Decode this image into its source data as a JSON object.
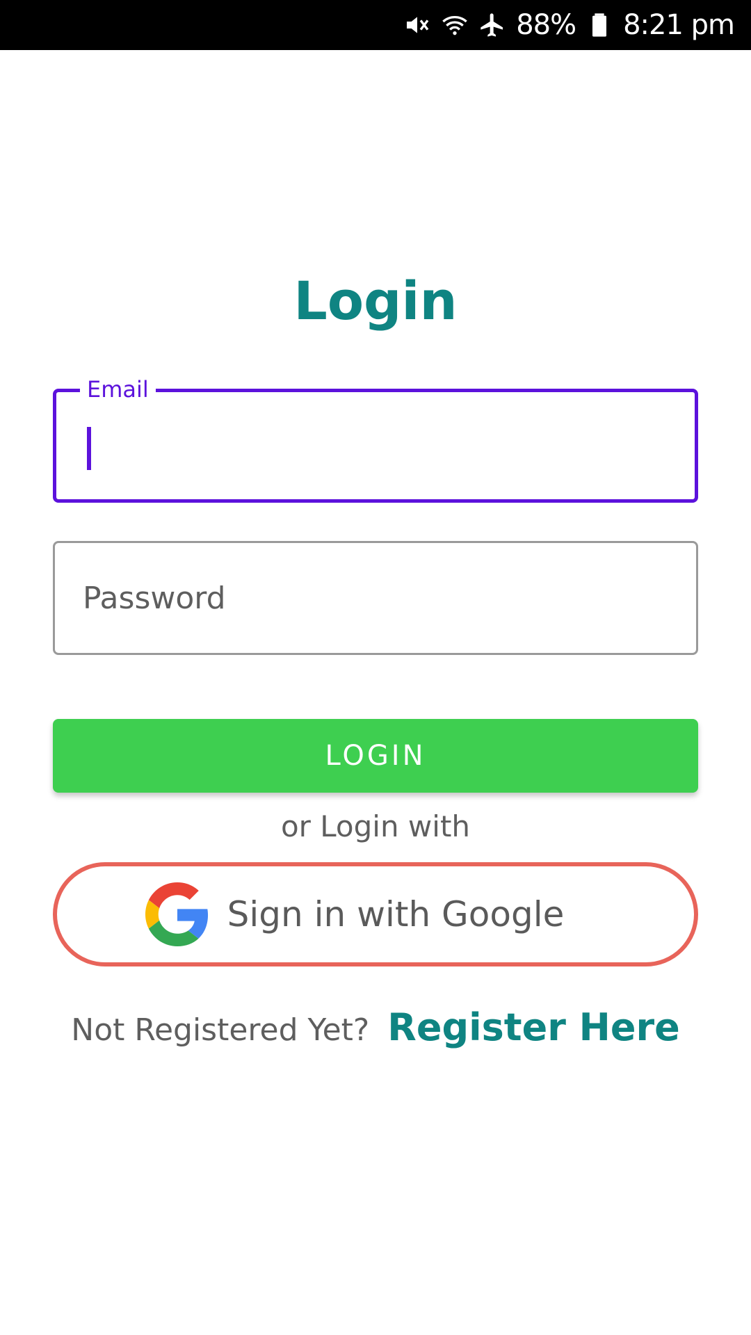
{
  "status_bar": {
    "battery": "88%",
    "time": "8:21 pm",
    "icons": [
      "mute-icon",
      "wifi-icon",
      "airplane-icon",
      "battery-icon"
    ]
  },
  "title": "Login",
  "email_field": {
    "label": "Email",
    "value": ""
  },
  "password_field": {
    "placeholder": "Password",
    "value": ""
  },
  "login_button": {
    "label": "LOGIN"
  },
  "alt_login_text": "or Login with",
  "google_button": {
    "label": "Sign in with Google",
    "icon": "google-logo-icon"
  },
  "register": {
    "prompt": "Not Registered Yet?",
    "link": "Register Here"
  },
  "colors": {
    "accent": "#0f8482",
    "focus": "#5c12dc",
    "login_button": "#3ecf50",
    "google_border": "#e8645a"
  }
}
